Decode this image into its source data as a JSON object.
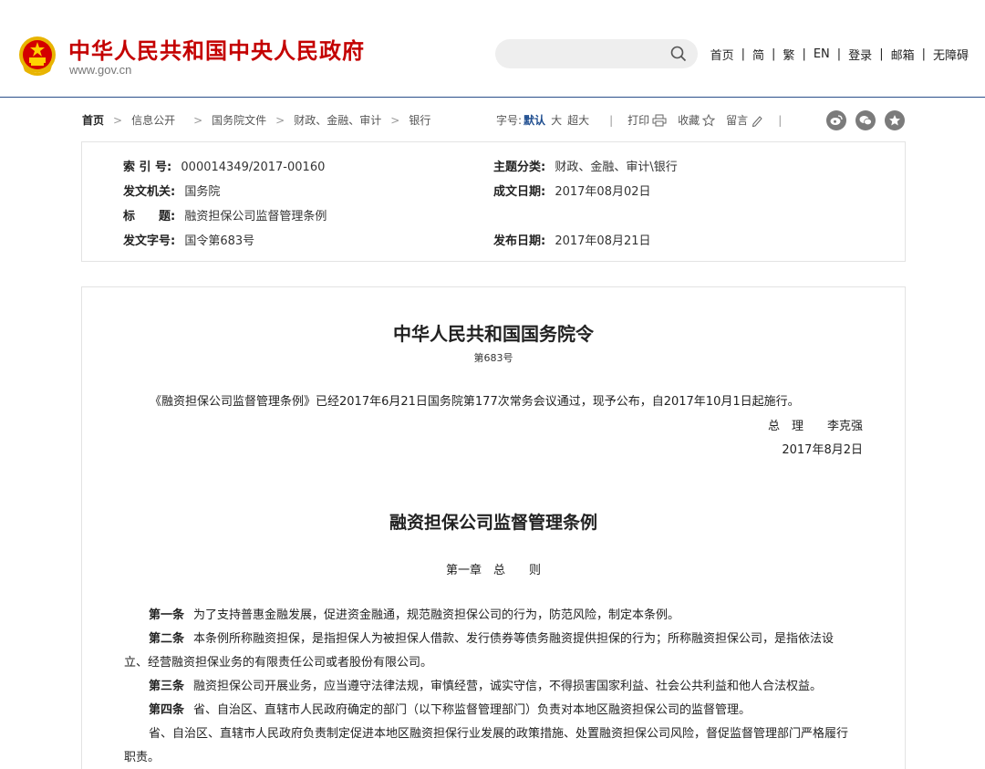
{
  "header": {
    "title": "中华人民共和国中央人民政府",
    "url": "www.gov.cn",
    "search_placeholder": "",
    "nav": [
      "首页",
      "简",
      "繁",
      "EN",
      "登录",
      "邮箱",
      "无障碍"
    ],
    "nav_sep": "|"
  },
  "breadcrumb": {
    "items": [
      "首页",
      "信息公开",
      "国务院文件",
      "财政、金融、审计",
      "银行"
    ],
    "arrow": ">"
  },
  "tools": {
    "font_label": "字号:",
    "font_options": [
      "默认",
      "大",
      "超大"
    ],
    "sep": "|",
    "print": "打印",
    "favorite": "收藏",
    "message": "留言",
    "sep2": "|"
  },
  "meta": {
    "index_label": "索 引 号:",
    "index_value": "000014349/2017-00160",
    "category_label": "主题分类:",
    "category_value": "财政、金融、审计\\银行",
    "issuer_label": "发文机关:",
    "issuer_value": "国务院",
    "created_label": "成文日期:",
    "created_value": "2017年08月02日",
    "title_label": "标　　题:",
    "title_value": "融资担保公司监督管理条例",
    "docno_label": "发文字号:",
    "docno_value": "国令第683号",
    "published_label": "发布日期:",
    "published_value": "2017年08月21日"
  },
  "article": {
    "order_title": "中华人民共和国国务院令",
    "order_no": "第683号",
    "intro": "《融资担保公司监督管理条例》已经2017年6月21日国务院第177次常务会议通过，现予公布，自2017年10月1日起施行。",
    "signer": "总　理　　李克强",
    "sign_date": "2017年8月2日",
    "reg_title": "融资担保公司监督管理条例",
    "chapter": "第一章　总　　则",
    "art1_label": "第一条",
    "art1_text": "为了支持普惠金融发展，促进资金融通，规范融资担保公司的行为，防范风险，制定本条例。",
    "art2_label": "第二条",
    "art2_text_line1": "本条例所称融资担保，是指担保人为被担保人借款、发行债券等债务融资提供担保的行为；所称融资担保公司，是指依法设",
    "art2_text_line2": "立、经营融资担保业务的有限责任公司或者股份有限公司。",
    "art3_label": "第三条",
    "art3_text": "融资担保公司开展业务，应当遵守法律法规，审慎经营，诚实守信，不得损害国家利益、社会公共利益和他人合法权益。",
    "art4_label": "第四条",
    "art4_text": "省、自治区、直辖市人民政府确定的部门（以下称监督管理部门）负责对本地区融资担保公司的监督管理。",
    "art4_p2_line1": "省、自治区、直辖市人民政府负责制定促进本地区融资担保行业发展的政策措施、处置融资担保公司风险，督促监督管理部门严格履行",
    "art4_p2_line2": "职责。"
  },
  "colors": {
    "brand_red": "#c40000",
    "accent_blue": "#1e4d8f",
    "header_rule": "#2a4f8a"
  }
}
